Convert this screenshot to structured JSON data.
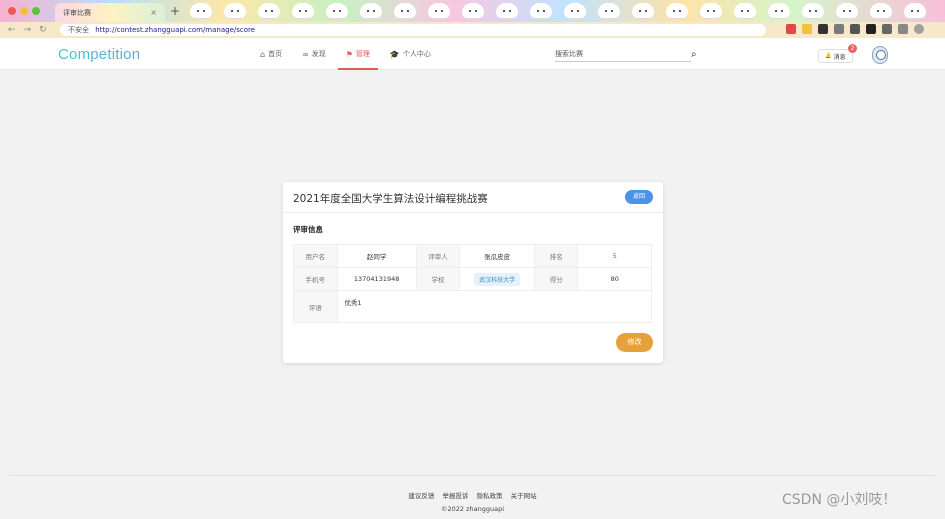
{
  "browser": {
    "tab_title": "评审比赛",
    "tab_close": "×",
    "new_tab": "+",
    "insecure_label": "不安全",
    "url": "http://contest.zhangguapi.com/manage/score",
    "nav_back": "←",
    "nav_forward": "→",
    "nav_reload": "↻"
  },
  "header": {
    "logo": "Competition",
    "nav": [
      {
        "icon": "home-icon",
        "glyph": "⌂",
        "label": "首页"
      },
      {
        "icon": "infinity-icon",
        "glyph": "∞",
        "label": "发现"
      },
      {
        "icon": "flag-icon",
        "glyph": "⚑",
        "label": "管理"
      },
      {
        "icon": "graduation-cap-icon",
        "glyph": "🎓",
        "label": "个人中心"
      }
    ],
    "search_placeholder": "搜索比赛",
    "message_label": "消息",
    "message_icon": "🔔",
    "message_count": "2"
  },
  "card": {
    "title": "2021年度全国大学生算法设计编程挑战赛",
    "back_label": "返回",
    "section_label": "评审信息",
    "fields": {
      "username_label": "用户名",
      "username_value": "赵同学",
      "reviewer_label": "评审人",
      "reviewer_value": "张瓜皮皮",
      "rank_label": "排名",
      "rank_value": "5",
      "phone_label": "手机号",
      "phone_value": "13704131948",
      "school_label": "学校",
      "school_value": "武汉科技大学",
      "score_label": "得分",
      "score_value": "80",
      "comment_label": "评语",
      "comment_value": "优秀1"
    },
    "edit_label": "修改"
  },
  "footer": {
    "links": [
      "建议反馈",
      "举报投诉",
      "隐私政策",
      "关于网站"
    ],
    "copyright": "©2022 zhangguapi"
  },
  "watermark": "CSDN @小刘吱！",
  "colors": {
    "accent_red": "#e05a5a",
    "primary_blue": "#4a93e8",
    "edit_orange": "#e8a03a",
    "rank_blue": "#2d7fd8"
  }
}
